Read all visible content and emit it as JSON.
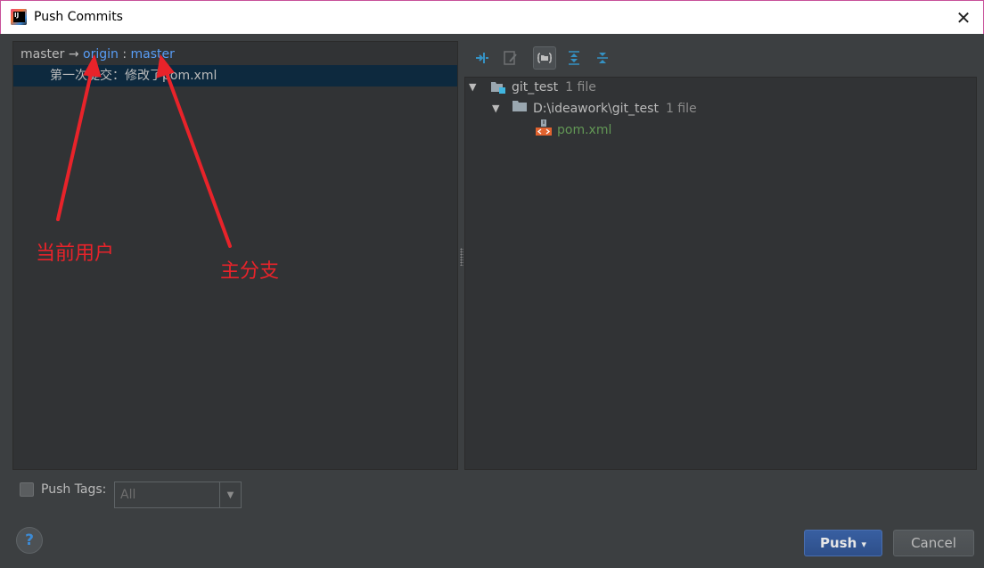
{
  "window": {
    "title": "Push Commits"
  },
  "left_panel": {
    "branch": {
      "local": "master",
      "arrow": "→",
      "remote": "origin",
      "separator": ":",
      "remote_branch": "master"
    },
    "commits": [
      {
        "message": "第一次提交：修改了pom.xml"
      }
    ]
  },
  "annotations": {
    "current_user": "当前用户",
    "main_branch": "主分支"
  },
  "tree": {
    "root": {
      "name": "git_test",
      "count": "1 file"
    },
    "folder": {
      "name": "D:\\ideawork\\git_test",
      "count": "1 file"
    },
    "file": {
      "name": "pom.xml"
    }
  },
  "footer": {
    "push_tags_label": "Push Tags:",
    "tags_value": "All",
    "help": "?",
    "push_label": "Push",
    "push_dropdown": "▾",
    "cancel_label": "Cancel"
  },
  "colors": {
    "link": "#589df6",
    "selection": "#0d293e",
    "annotation": "#e8232a",
    "file_added": "#629755",
    "push_button": "#365880"
  }
}
